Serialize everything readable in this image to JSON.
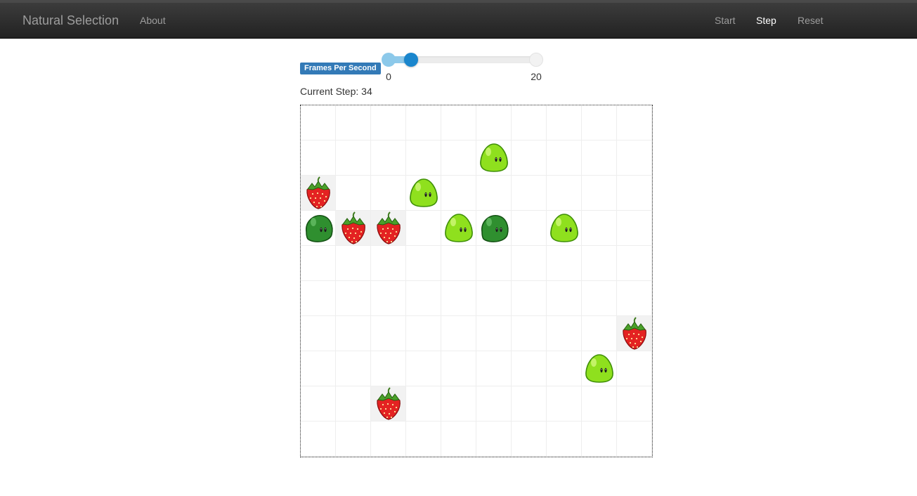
{
  "navbar": {
    "brand": "Natural Selection",
    "links": {
      "about": "About",
      "start": "Start",
      "step": "Step",
      "reset": "Reset"
    },
    "active": "step"
  },
  "controls": {
    "fps_label": "Frames Per Second",
    "slider": {
      "min": 0,
      "max": 20,
      "value": 3,
      "min_label": "0",
      "max_label": "20"
    },
    "current_step_text": "Current Step: 34"
  },
  "colors": {
    "navbar_active": "#ffffff",
    "label_bg": "#337ab7",
    "slider_handle": "#1a86cd",
    "slider_fill": "#8ec9ea"
  },
  "board": {
    "rows": 10,
    "cols": 10,
    "entities": [
      {
        "type": "light-creature",
        "row": 1,
        "col": 5
      },
      {
        "type": "strawberry",
        "row": 2,
        "col": 0
      },
      {
        "type": "light-creature",
        "row": 2,
        "col": 3
      },
      {
        "type": "dark-creature",
        "row": 3,
        "col": 0
      },
      {
        "type": "strawberry",
        "row": 3,
        "col": 1
      },
      {
        "type": "strawberry",
        "row": 3,
        "col": 2
      },
      {
        "type": "light-creature",
        "row": 3,
        "col": 4
      },
      {
        "type": "dark-creature",
        "row": 3,
        "col": 5
      },
      {
        "type": "light-creature",
        "row": 3,
        "col": 7
      },
      {
        "type": "strawberry",
        "row": 6,
        "col": 9
      },
      {
        "type": "light-creature",
        "row": 7,
        "col": 8
      },
      {
        "type": "strawberry",
        "row": 8,
        "col": 2
      }
    ]
  }
}
